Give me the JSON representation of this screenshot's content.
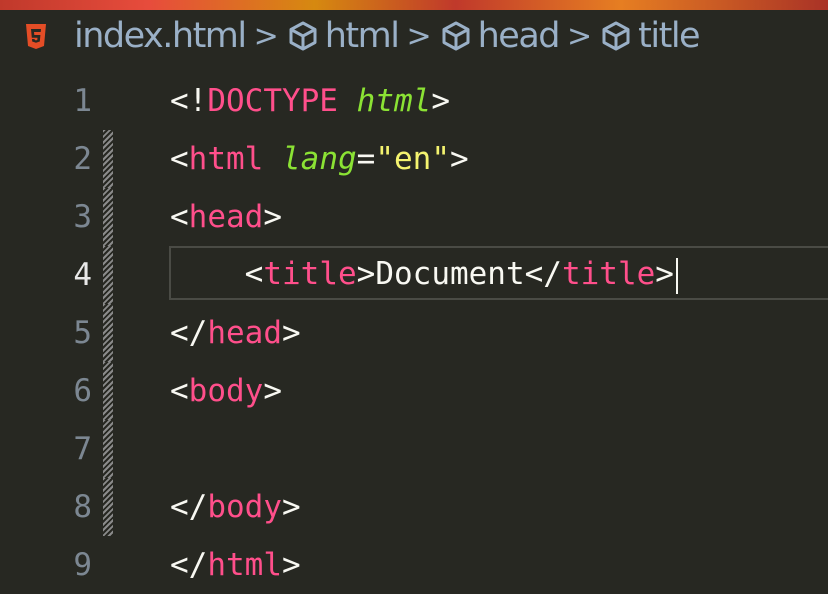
{
  "breadcrumb": {
    "file": "index.html",
    "separator": ">",
    "items": [
      "html",
      "head",
      "title"
    ]
  },
  "editor": {
    "active_line": 4,
    "lines": [
      {
        "number": "1",
        "text": "<!DOCTYPE html>"
      },
      {
        "number": "2",
        "text": "<html lang=\"en\">"
      },
      {
        "number": "3",
        "text": "<head>"
      },
      {
        "number": "4",
        "text": "    <title>Document</title>"
      },
      {
        "number": "5",
        "text": "</head>"
      },
      {
        "number": "6",
        "text": "<body>"
      },
      {
        "number": "7",
        "text": ""
      },
      {
        "number": "8",
        "text": "</body>"
      },
      {
        "number": "9",
        "text": "</html>"
      }
    ]
  },
  "colors": {
    "background": "#272822",
    "tag": "#ff4f8b",
    "attribute": "#8be234",
    "string": "#f4f36f",
    "line_number": "#7c8792",
    "html5_icon": "#e44d26"
  },
  "icons": {
    "file_icon": "html5-icon",
    "symbol_icon": "cube-icon"
  }
}
